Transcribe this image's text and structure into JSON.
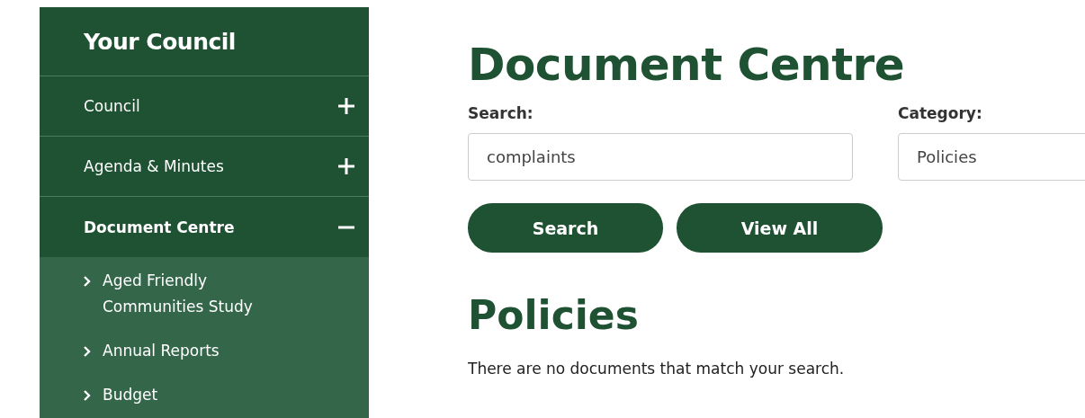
{
  "sidebar": {
    "title": "Your Council",
    "items": [
      {
        "label": "Council",
        "selected": false,
        "expanded": false
      },
      {
        "label": "Agenda & Minutes",
        "selected": false,
        "expanded": false
      },
      {
        "label": "Document Centre",
        "selected": true,
        "expanded": true,
        "children": [
          {
            "label": "Aged Friendly Communities Study"
          },
          {
            "label": "Annual Reports"
          },
          {
            "label": "Budget"
          }
        ]
      }
    ]
  },
  "main": {
    "title": "Document Centre",
    "search": {
      "label": "Search:",
      "value": "complaints"
    },
    "category": {
      "label": "Category:",
      "value": "Policies"
    },
    "buttons": [
      "Search",
      "View All"
    ],
    "results": {
      "heading": "Policies",
      "message": "There are no documents that match your search."
    }
  }
}
